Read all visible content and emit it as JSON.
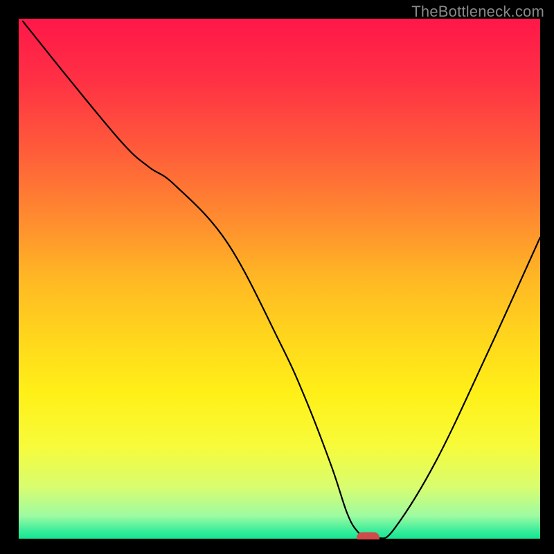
{
  "watermark": "TheBottleneck.com",
  "chart_data": {
    "type": "line",
    "title": "",
    "xlabel": "",
    "ylabel": "",
    "x_range": [
      0,
      100
    ],
    "y_range": [
      0,
      100
    ],
    "background": {
      "kind": "vertical-gradient",
      "stops": [
        {
          "pos": 0.0,
          "color": "#ff1749"
        },
        {
          "pos": 0.12,
          "color": "#ff3144"
        },
        {
          "pos": 0.25,
          "color": "#ff5b3a"
        },
        {
          "pos": 0.38,
          "color": "#ff8a30"
        },
        {
          "pos": 0.5,
          "color": "#ffb824"
        },
        {
          "pos": 0.62,
          "color": "#ffd81c"
        },
        {
          "pos": 0.72,
          "color": "#fff018"
        },
        {
          "pos": 0.82,
          "color": "#f7fb3a"
        },
        {
          "pos": 0.9,
          "color": "#d8fd70"
        },
        {
          "pos": 0.955,
          "color": "#9dfba2"
        },
        {
          "pos": 0.985,
          "color": "#34ec9a"
        },
        {
          "pos": 1.0,
          "color": "#13e58f"
        }
      ]
    },
    "series": [
      {
        "name": "bottleneck-curve",
        "color": "#000000",
        "width": 2.2,
        "x": [
          0.8,
          10,
          20,
          25,
          30,
          40,
          50,
          55,
          60,
          63,
          65,
          67,
          69,
          72,
          80,
          90,
          100
        ],
        "y": [
          99.5,
          88,
          76,
          71.5,
          68,
          57,
          38,
          27,
          14,
          5,
          1.5,
          0.2,
          0.2,
          2,
          15,
          36,
          58
        ]
      }
    ],
    "marker": {
      "name": "optimal-point",
      "shape": "rounded-pill",
      "color": "#d04a4a",
      "cx": 67,
      "cy": 0.3,
      "rx": 2.2,
      "ry": 1.1
    },
    "baseline": {
      "color": "#000000",
      "y": 0,
      "width": 2.2
    }
  }
}
